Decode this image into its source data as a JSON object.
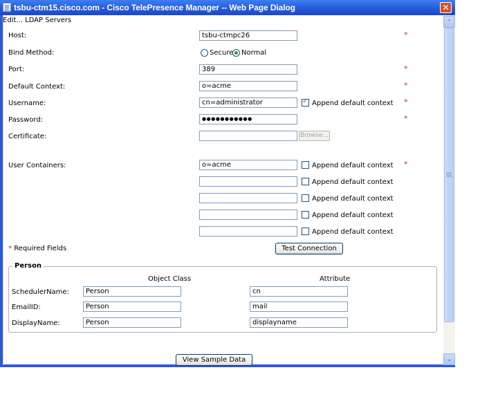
{
  "window": {
    "title": "tsbu-ctm15.cisco.com - Cisco TelePresence Manager -- Web Page Dialog",
    "close_glyph": "✕"
  },
  "breadcrumb": "Edit... LDAP Servers",
  "fields": {
    "host": {
      "label": "Host:",
      "value": "tsbu-ctmpc26"
    },
    "bind_method": {
      "label": "Bind Method:",
      "options": [
        "Secure",
        "Normal"
      ],
      "selected": "Normal"
    },
    "port": {
      "label": "Port:",
      "value": "389"
    },
    "default_context": {
      "label": "Default Context:",
      "value": "o=acme"
    },
    "username": {
      "label": "Username:",
      "value": "cn=administrator",
      "append_label": "Append default context",
      "append_checked": true
    },
    "password": {
      "label": "Password:",
      "value": "●●●●●●●●●●●"
    },
    "certificate": {
      "label": "Certificate:",
      "value": "",
      "browse_label": "Browse..."
    },
    "user_containers": {
      "label": "User Containers:",
      "rows": [
        {
          "value": "o=acme",
          "append_label": "Append default context",
          "checked": false
        },
        {
          "value": "",
          "append_label": "Append default context",
          "checked": false
        },
        {
          "value": "",
          "append_label": "Append default context",
          "checked": false
        },
        {
          "value": "",
          "append_label": "Append default context",
          "checked": false
        },
        {
          "value": "",
          "append_label": "Append default context",
          "checked": false
        }
      ]
    }
  },
  "required_marker": "*",
  "required_note": "Required Fields",
  "test_connection_label": "Test Connection",
  "person": {
    "legend": "Person",
    "col_object_class": "Object Class",
    "col_attribute": "Attribute",
    "rows": [
      {
        "label": "SchedulerName:",
        "object_class": "Person",
        "attribute": "cn"
      },
      {
        "label": "EmailID:",
        "object_class": "Person",
        "attribute": "mail"
      },
      {
        "label": "DisplayName:",
        "object_class": "Person",
        "attribute": "displayname"
      }
    ]
  },
  "view_sample_label": "View Sample Data",
  "scrollbar": {
    "up_glyph": "⌃",
    "down_glyph": "⌄"
  },
  "colors": {
    "titlebar": "#2458d6",
    "required": "#dd2222",
    "check": "#21a121"
  }
}
